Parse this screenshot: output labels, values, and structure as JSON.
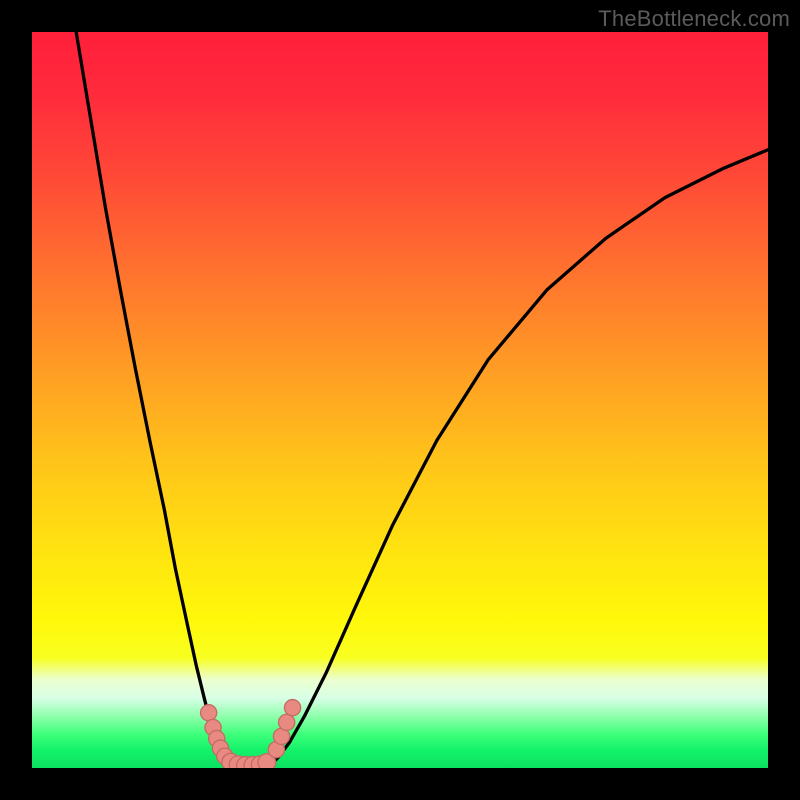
{
  "watermark": "TheBottleneck.com",
  "colors": {
    "black": "#000000",
    "curve": "#000000",
    "marker_fill": "#e98a82",
    "marker_stroke": "#c46b63"
  },
  "gradient_stops": [
    {
      "offset": 0.0,
      "color": "#ff1f3a"
    },
    {
      "offset": 0.08,
      "color": "#ff2a3c"
    },
    {
      "offset": 0.18,
      "color": "#ff4438"
    },
    {
      "offset": 0.3,
      "color": "#ff6a30"
    },
    {
      "offset": 0.45,
      "color": "#ff9a25"
    },
    {
      "offset": 0.58,
      "color": "#ffc31a"
    },
    {
      "offset": 0.72,
      "color": "#ffe70f"
    },
    {
      "offset": 0.8,
      "color": "#fff80a"
    },
    {
      "offset": 0.85,
      "color": "#f8ff20"
    },
    {
      "offset": 0.88,
      "color": "#ecffd0"
    },
    {
      "offset": 0.905,
      "color": "#d8ffe6"
    },
    {
      "offset": 0.93,
      "color": "#8dffab"
    },
    {
      "offset": 0.955,
      "color": "#3cff7a"
    },
    {
      "offset": 0.975,
      "color": "#14f36a"
    },
    {
      "offset": 1.0,
      "color": "#0be060"
    }
  ],
  "chart_data": {
    "type": "line",
    "title": "",
    "xlabel": "",
    "ylabel": "",
    "xlim": [
      0,
      100
    ],
    "ylim": [
      0,
      100
    ],
    "series": [
      {
        "name": "left-branch",
        "x": [
          6.0,
          8.0,
          10.0,
          12.0,
          14.0,
          16.0,
          18.0,
          19.5,
          21.0,
          22.3,
          23.4,
          24.3,
          25.0,
          25.6,
          26.1,
          26.5
        ],
        "y": [
          100.0,
          88.0,
          76.0,
          65.0,
          54.5,
          44.5,
          35.0,
          27.0,
          20.0,
          14.0,
          9.5,
          6.0,
          3.5,
          2.0,
          1.0,
          0.5
        ]
      },
      {
        "name": "floor",
        "x": [
          26.5,
          27.5,
          28.5,
          29.5,
          30.5,
          31.5,
          32.5
        ],
        "y": [
          0.5,
          0.3,
          0.25,
          0.25,
          0.25,
          0.3,
          0.5
        ]
      },
      {
        "name": "right-branch",
        "x": [
          32.5,
          33.5,
          35.0,
          37.0,
          40.0,
          44.0,
          49.0,
          55.0,
          62.0,
          70.0,
          78.0,
          86.0,
          94.0,
          100.0
        ],
        "y": [
          0.5,
          1.5,
          3.5,
          7.0,
          13.0,
          22.0,
          33.0,
          44.5,
          55.5,
          65.0,
          72.0,
          77.5,
          81.5,
          84.0
        ]
      }
    ],
    "markers": [
      {
        "x": 24.0,
        "y": 7.5,
        "r": 1.1
      },
      {
        "x": 24.6,
        "y": 5.5,
        "r": 1.1
      },
      {
        "x": 25.1,
        "y": 4.0,
        "r": 1.1
      },
      {
        "x": 25.6,
        "y": 2.7,
        "r": 1.1
      },
      {
        "x": 26.2,
        "y": 1.6,
        "r": 1.1
      },
      {
        "x": 27.0,
        "y": 0.8,
        "r": 1.2
      },
      {
        "x": 28.0,
        "y": 0.45,
        "r": 1.2
      },
      {
        "x": 29.0,
        "y": 0.35,
        "r": 1.2
      },
      {
        "x": 30.0,
        "y": 0.35,
        "r": 1.2
      },
      {
        "x": 31.0,
        "y": 0.45,
        "r": 1.2
      },
      {
        "x": 31.9,
        "y": 0.75,
        "r": 1.2
      },
      {
        "x": 33.2,
        "y": 2.5,
        "r": 1.1
      },
      {
        "x": 33.9,
        "y": 4.3,
        "r": 1.1
      },
      {
        "x": 34.6,
        "y": 6.2,
        "r": 1.1
      },
      {
        "x": 35.4,
        "y": 8.2,
        "r": 1.1
      }
    ]
  }
}
